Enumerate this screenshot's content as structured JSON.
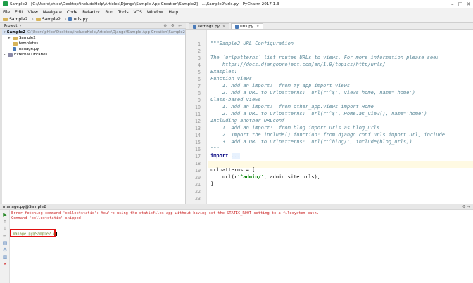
{
  "window": {
    "title": "Sample2 - [C:\\Users\\phloe\\Desktop\\includeHelp\\Articles\\Django\\Sample App Creation\\Sample2] - ...\\Sample2\\urls.py - PyCharm 2017.1.3"
  },
  "menu": [
    "File",
    "Edit",
    "View",
    "Navigate",
    "Code",
    "Refactor",
    "Run",
    "Tools",
    "VCS",
    "Window",
    "Help"
  ],
  "breadcrumbs": [
    "Sample2",
    "Sample2",
    "urls.py"
  ],
  "project": {
    "header": "Project",
    "tree": [
      {
        "label": "Sample2",
        "path": "C:\\Users\\phloe\\Desktop\\includeHelp\\Articles\\Django\\Sample App Creation\\Sample2"
      },
      {
        "label": "Sample2"
      },
      {
        "label": "templates"
      },
      {
        "label": "manage.py"
      },
      {
        "label": "External Libraries"
      }
    ]
  },
  "tabs": [
    {
      "label": "settings.py"
    },
    {
      "label": "urls.py"
    }
  ],
  "editor": {
    "line_numbers": [
      "1",
      "2",
      "3",
      "4",
      "5",
      "6",
      "7",
      "8",
      "9",
      "10",
      "11",
      "12",
      "13",
      "14",
      "15",
      "16",
      "17",
      "18",
      "19",
      "20",
      "21",
      "22",
      "23"
    ],
    "lines": [
      "\"\"\"Sample2 URL Configuration",
      "",
      "The `urlpatterns` list routes URLs to views. For more information please see:",
      "    https://docs.djangoproject.com/en/1.9/topics/http/urls/",
      "Examples:",
      "Function views",
      "    1. Add an import:  from my_app import views",
      "    2. Add a URL to urlpatterns:  url(r'^$', views.home, name='home')",
      "Class-based views",
      "    1. Add an import:  from other_app.views import Home",
      "    2. Add a URL to urlpatterns:  url(r'^$', Home.as_view(), name='home')",
      "Including another URLconf",
      "    1. Add an import:  from blog import urls as blog_urls",
      "    2. Import the include() function: from django.conf.urls import url, include",
      "    3. Add a URL to urlpatterns:  url(r'^blog/', include(blog_urls))",
      "\"\"\"",
      "import ...",
      "",
      "urlpatterns = [",
      "    url(r'^admin/', admin.site.urls),",
      "]",
      "",
      ""
    ],
    "import_keyword": "import",
    "import_fold": "...",
    "url_prefix": "    url(r",
    "url_string": "'^admin/'",
    "url_suffix": ", admin.site.urls),"
  },
  "run": {
    "title": "manage.py@Sample2",
    "messages": [
      "Error fetching command 'collectstatic': You're using the staticfiles app without having set the STATIC_ROOT setting to a filesystem path.",
      "Command 'collectstatic' skipped"
    ],
    "prompt": "manage.py@Sample2 >"
  },
  "colors": {
    "error": "#c81e1e",
    "highlight_box": "#e01010",
    "docstring": "#5d8a9a",
    "keyword": "#000080",
    "string": "#008000"
  }
}
